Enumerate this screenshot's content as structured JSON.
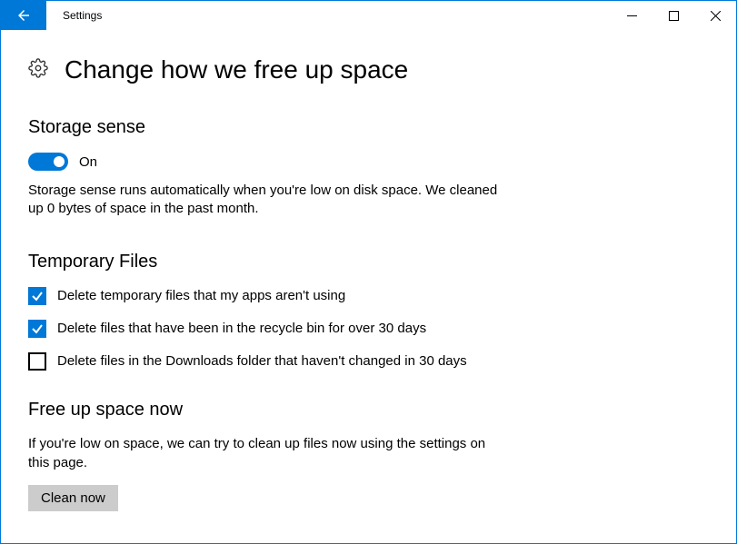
{
  "window": {
    "title": "Settings"
  },
  "page": {
    "title": "Change how we free up space"
  },
  "storage_sense": {
    "heading": "Storage sense",
    "toggle_label": "On",
    "toggle_on": true,
    "description": "Storage sense runs automatically when you're low on disk space. We cleaned up 0 bytes of space in the past month."
  },
  "temp_files": {
    "heading": "Temporary Files",
    "items": [
      {
        "checked": true,
        "label": "Delete temporary files that my apps aren't using"
      },
      {
        "checked": true,
        "label": "Delete files that have been in the recycle bin for over 30 days"
      },
      {
        "checked": false,
        "label": "Delete files in the Downloads folder that haven't changed in 30 days"
      }
    ]
  },
  "free_up": {
    "heading": "Free up space now",
    "description": "If you're low on space, we can try to clean up files now using the settings on this page.",
    "button_label": "Clean now"
  }
}
